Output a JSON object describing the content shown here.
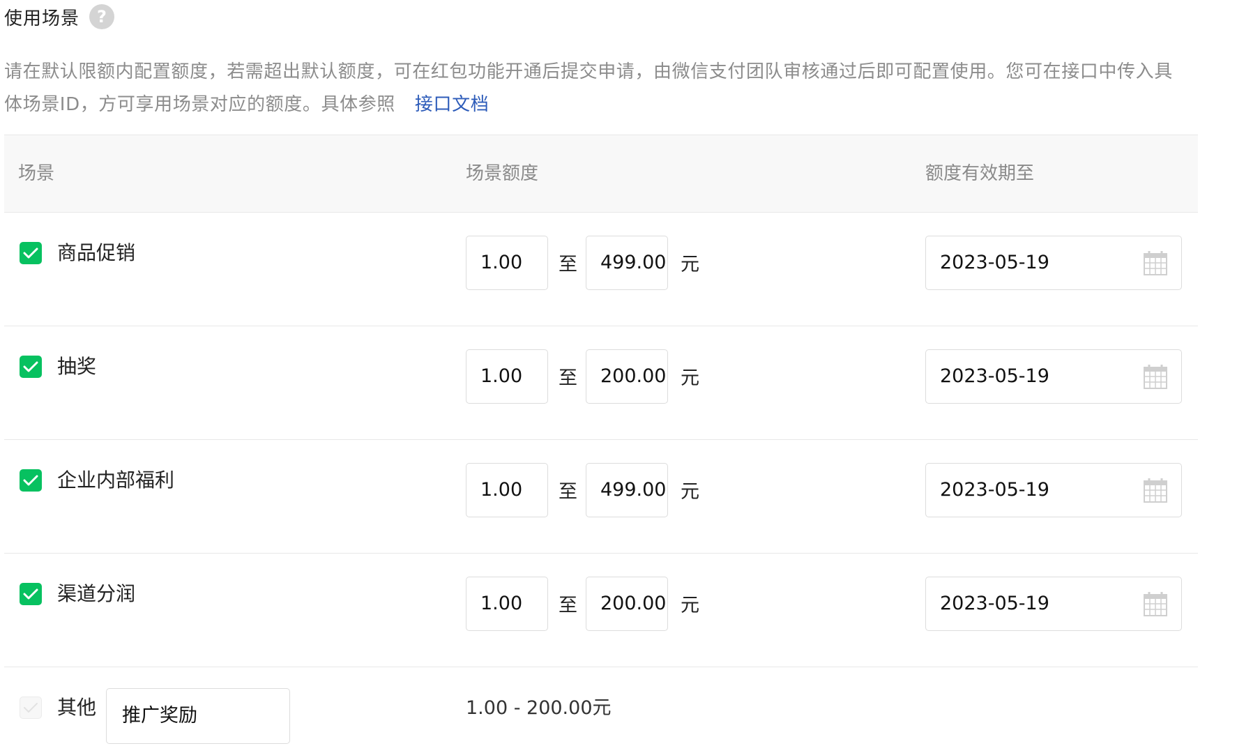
{
  "header": {
    "title": "使用场景",
    "help_icon": "?"
  },
  "description": {
    "text": "请在默认限额内配置额度，若需超出默认额度，可在红包功能开通后提交申请，由微信支付团队审核通过后即可配置使用。您可在接口中传入具体场景ID，方可享用场景对应的额度。具体参照",
    "link_text": "接口文档"
  },
  "table": {
    "columns": [
      "场景",
      "场景额度",
      "额度有效期至"
    ],
    "separator": "至",
    "unit": "元",
    "rows": [
      {
        "name": "商品促销",
        "min": "1.00",
        "max": "499.00",
        "expiry": "2023-05-19"
      },
      {
        "name": "抽奖",
        "min": "1.00",
        "max": "200.00",
        "expiry": "2023-05-19"
      },
      {
        "name": "企业内部福利",
        "min": "1.00",
        "max": "499.00",
        "expiry": "2023-05-19"
      },
      {
        "name": "渠道分润",
        "min": "1.00",
        "max": "200.00",
        "expiry": "2023-05-19"
      }
    ],
    "other": {
      "name": "其他",
      "input_value": "推广奖励",
      "range_text": "1.00 - 200.00元"
    }
  },
  "colors": {
    "accent_green": "#07c160",
    "link_blue": "#2c5bb9",
    "muted_text": "#8c8c8c"
  }
}
